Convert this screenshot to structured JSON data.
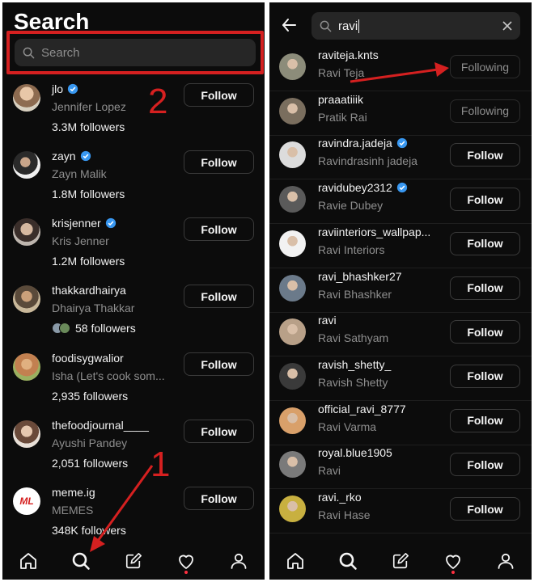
{
  "left": {
    "title": "Search",
    "search_placeholder": "Search",
    "suggestions": [
      {
        "username": "jlo",
        "full_name": "Jennifer Lopez",
        "followers": "3.3M followers",
        "verified": true,
        "button": "Follow",
        "avatar_color": "#c89b7e"
      },
      {
        "username": "zayn",
        "full_name": "Zayn Malik",
        "followers": "1.8M followers",
        "verified": true,
        "button": "Follow",
        "avatar_color": "#4a4a4a"
      },
      {
        "username": "krisjenner",
        "full_name": "Kris Jenner",
        "followers": "1.2M followers",
        "verified": true,
        "button": "Follow",
        "avatar_color": "#8a7a72"
      },
      {
        "username": "thakkardhairya",
        "full_name": "Dhairya Thakkar",
        "followers": "58 followers",
        "verified": false,
        "button": "Follow",
        "avatar_color": "#a68a64",
        "mutual_avatars": true
      },
      {
        "username": "foodisygwalior",
        "full_name": "Isha (Let's cook som...",
        "followers": "2,935 followers",
        "verified": false,
        "button": "Follow",
        "avatar_color": "#c2a06a"
      },
      {
        "username": "thefoodjournal____",
        "full_name": "Ayushi Pandey",
        "followers": "2,051 followers",
        "verified": false,
        "button": "Follow",
        "avatar_color": "#b08a72"
      },
      {
        "username": "meme.ig",
        "full_name": "MEMES",
        "followers": "348K followers",
        "verified": false,
        "button": "Follow",
        "avatar_color": "#ffffff"
      }
    ],
    "annotations": {
      "one": "1",
      "two": "2"
    }
  },
  "right": {
    "query": "ravi",
    "results": [
      {
        "username": "raviteja.knts",
        "full_name": "Ravi Teja",
        "verified": false,
        "button": "Following",
        "avatar_color": "#8c8c7a"
      },
      {
        "username": "praaatiiik",
        "full_name": "Pratik Rai",
        "verified": false,
        "button": "Following",
        "avatar_color": "#7a6e5e"
      },
      {
        "username": "ravindra.jadeja",
        "full_name": "Ravindrasinh jadeja",
        "verified": true,
        "button": "Follow",
        "avatar_color": "#dcdcdc"
      },
      {
        "username": "ravidubey2312",
        "full_name": "Ravie Dubey",
        "verified": true,
        "button": "Follow",
        "avatar_color": "#5a5a5a"
      },
      {
        "username": "raviinteriors_wallpap...",
        "full_name": "Ravi Interiors",
        "verified": false,
        "button": "Follow",
        "avatar_color": "#f2f2f2"
      },
      {
        "username": "ravi_bhashker27",
        "full_name": "Ravi Bhashker",
        "verified": false,
        "button": "Follow",
        "avatar_color": "#6b7a8a"
      },
      {
        "username": "ravi",
        "full_name": "Ravi Sathyam",
        "verified": false,
        "button": "Follow",
        "avatar_color": "#b8a088"
      },
      {
        "username": "ravish_shetty_",
        "full_name": "Ravish Shetty",
        "verified": false,
        "button": "Follow",
        "avatar_color": "#3a3a3a"
      },
      {
        "username": "official_ravi_8777",
        "full_name": "Ravi Varma",
        "verified": false,
        "button": "Follow",
        "avatar_color": "#d9a06a"
      },
      {
        "username": "royal.blue1905",
        "full_name": "Ravi",
        "verified": false,
        "button": "Follow",
        "avatar_color": "#7a7a7a"
      },
      {
        "username": "ravi._rko",
        "full_name": "Ravi Hase",
        "verified": false,
        "button": "Follow",
        "avatar_color": "#c8b040"
      }
    ]
  },
  "nav": [
    "home-icon",
    "search-icon",
    "create-post-icon",
    "activity-heart-icon",
    "profile-icon"
  ],
  "colors": {
    "background": "#0c0c0c",
    "annotation_red": "#d52020",
    "verified_blue": "#3897f0",
    "notification_dot": "#ff3040"
  }
}
